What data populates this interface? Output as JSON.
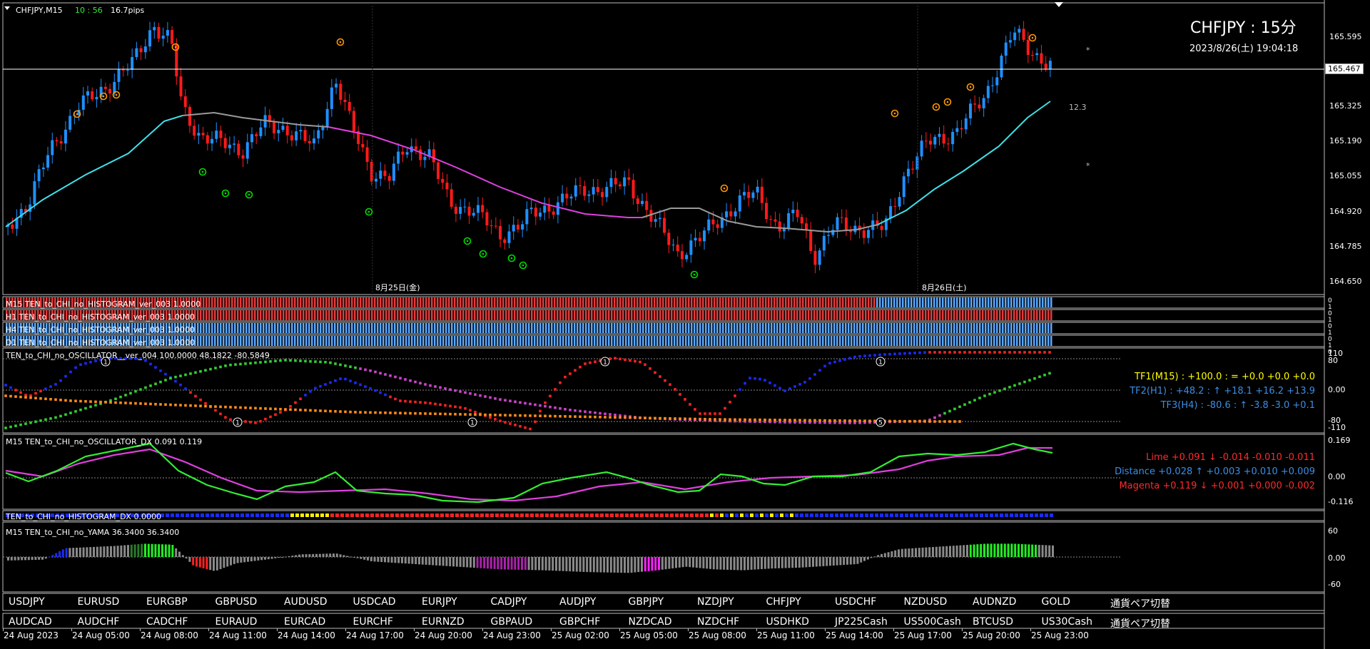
{
  "header": {
    "symbol_tf": "CHFJPY,M15",
    "time_left": "10 : 56",
    "spread": "16.7pips",
    "title_big": "CHFJPY : 15分",
    "datetime": "2023/8/26(土) 19:04:18",
    "side_value": "12.3"
  },
  "price_axis": {
    "labels": [
      "165.595",
      "165.325",
      "165.190",
      "165.055",
      "164.920",
      "164.785",
      "164.650"
    ],
    "current_price": "165.467"
  },
  "date_separators": [
    "8月25日(金)",
    "8月26日(土)"
  ],
  "histogram_rows": [
    {
      "label": "M15 TEN_to_CHI_no_HISTOGRAM_ver_003 1.0000",
      "blue_from": 0.83
    },
    {
      "label": "H1 TEN_to_CHI_no_HISTOGRAM_ver_003 1.0000",
      "blue_from": 1.0
    },
    {
      "label": "H4 TEN_to_CHI_no_HISTOGRAM_ver_003 1.0000",
      "blue_from": 0.0
    },
    {
      "label": "D1 TEN_to_CHI_no_HISTOGRAM_ver_003 1.0000",
      "blue_from": 0.0
    }
  ],
  "histogram_scale": [
    "0",
    "1",
    "0",
    "1",
    "0",
    "1",
    "0",
    "1",
    "0"
  ],
  "oscillator": {
    "label": "TEN_to_CHI_no_OSCILLATOR__ver_004 100.0000 48.1822 -80.5849",
    "axis": [
      "110",
      "80",
      "0.00",
      "-80",
      "-110"
    ],
    "tf_lines": [
      {
        "text": "TF1(M15) : +100.0 : = +0.0 +0.0 +0.0",
        "color": "#ffff00"
      },
      {
        "text": "TF2(H1) : +48.2 : ↑ +18.1 +16.2 +13.9",
        "color": "#3a8ee6"
      },
      {
        "text": "TF3(H4) : -80.6 : ↑ -3.8 -3.0 +0.1",
        "color": "#3a8ee6"
      }
    ],
    "markers": [
      "1",
      "1",
      "1",
      "1",
      "1",
      "5"
    ]
  },
  "dx": {
    "label": "M15 TEN_to_CHI_no_OSCILLATOR_DX 0.091 0.119",
    "axis": [
      "0.169",
      "0.00",
      "-0.116"
    ],
    "lines": [
      {
        "text": "Lime +0.091 ↓ -0.014 -0.010 -0.011",
        "color": "#ff2a2a"
      },
      {
        "text": "Distance +0.028 ↑ +0.003 +0.010 +0.009",
        "color": "#3a8ee6"
      },
      {
        "text": "Magenta +0.119 ↓ +0.001 +0.000 -0.002",
        "color": "#ff2a2a"
      }
    ]
  },
  "hist_dx": {
    "label": "TEN_to_CHI_no_HISTOGRAM_DX 0.0000"
  },
  "yama": {
    "label": "M15 TEN_to_CHI_no_YAMA 36.3400 36.3400",
    "axis": [
      "60",
      "0.00",
      "-60"
    ]
  },
  "pairs_row1": [
    "USDJPY",
    "EURUSD",
    "EURGBP",
    "GBPUSD",
    "AUDUSD",
    "USDCAD",
    "EURJPY",
    "CADJPY",
    "AUDJPY",
    "GBPJPY",
    "NZDJPY",
    "CHFJPY",
    "USDCHF",
    "NZDUSD",
    "AUDNZD",
    "GOLD",
    "通貨ペア切替"
  ],
  "pairs_row2": [
    "AUDCAD",
    "AUDCHF",
    "CADCHF",
    "EURAUD",
    "EURCAD",
    "EURCHF",
    "EURNZD",
    "GBPAUD",
    "GBPCHF",
    "NZDCAD",
    "NZDCHF",
    "USDHKD",
    "JP225Cash",
    "US500Cash",
    "BTCUSD",
    "US30Cash",
    "通貨ペア切替"
  ],
  "time_axis": [
    "24 Aug 2023",
    "24 Aug 05:00",
    "24 Aug 08:00",
    "24 Aug 11:00",
    "24 Aug 14:00",
    "24 Aug 17:00",
    "24 Aug 20:00",
    "24 Aug 23:00",
    "25 Aug 02:00",
    "25 Aug 05:00",
    "25 Aug 08:00",
    "25 Aug 11:00",
    "25 Aug 14:00",
    "25 Aug 17:00",
    "25 Aug 20:00",
    "25 Aug 23:00"
  ],
  "colors": {
    "bull": "#1e90ff",
    "bear": "#ff1a1a",
    "cyan_ma": "#40e0e8",
    "magenta_ma": "#e040e0",
    "gray_ma": "#9a9a9a",
    "lime": "#33ee33",
    "orange_marker": "#ff9900",
    "green_marker": "#00dd00"
  }
}
